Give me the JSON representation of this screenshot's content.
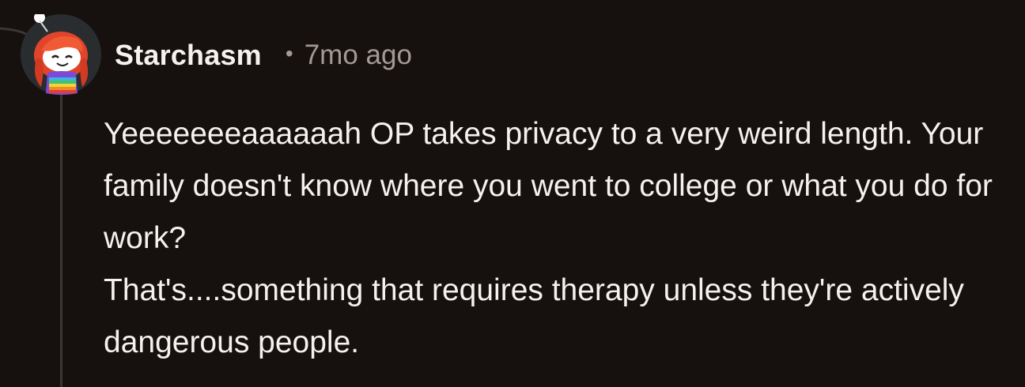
{
  "comment": {
    "author": "Starchasm",
    "separator": "•",
    "timestamp": "7mo ago",
    "paragraphs": [
      "Yeeeeeeeaaaaaah OP takes privacy to a very weird length. Your family doesn't know where you went to college or what you do for work?",
      "That's....something that requires therapy unless they're actively dangerous people."
    ]
  },
  "avatar": {
    "icon": "snoo-avatar-red-hair-rainbow-shirt"
  },
  "colors": {
    "background": "#16110f",
    "text": "#f4f1ee",
    "meta": "#a39a94",
    "thread_line": "#3b3633"
  }
}
